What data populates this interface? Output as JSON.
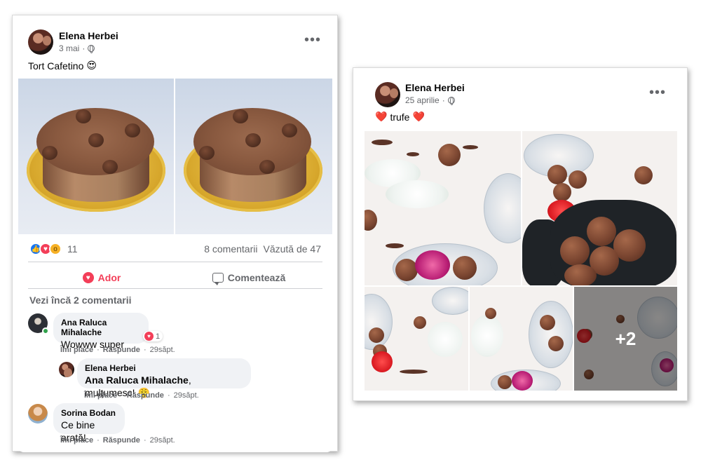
{
  "left_post": {
    "author": "Elena Herbei",
    "date": "3 mai",
    "separator": "·",
    "text": "Tort Cafetino",
    "text_emoji": "😍",
    "reaction_count": "11",
    "comments_count": "8 comentarii",
    "views": "Văzută de 47",
    "actions": {
      "like": "Ador",
      "comment": "Comentează"
    },
    "see_more": "Vezi încă 2 comentarii",
    "comments": [
      {
        "name": "Ana Raluca Mihalache",
        "text": "Wowww super",
        "reactions": "1",
        "like": "Îmi place",
        "reply": "Răspunde",
        "time": "29săpt."
      },
      {
        "name": "Elena Herbei",
        "mention": "Ana Raluca Mihalache",
        "text": ", mulțumesc!",
        "emoji": "😤",
        "like": "Îmi place",
        "reply": "Răspunde",
        "time": "29săpt."
      },
      {
        "name": "Sorina Bodan",
        "text": "Ce bine arată!",
        "like": "Îmi place",
        "reply": "Răspunde",
        "time": "29săpt."
      }
    ]
  },
  "right_post": {
    "author": "Elena Herbei",
    "date": "25 aprilie",
    "separator": "·",
    "text": "trufe",
    "text_emoji": "❤️",
    "more_photos": "+2"
  },
  "icons": {
    "more": "more-options-icon",
    "privacy": "globe-icon",
    "love": "heart-icon",
    "comment": "comment-icon"
  },
  "colors": {
    "love_red": "#f33e58",
    "like_blue": "#1877f2",
    "secondary_text": "#65676b",
    "bubble_bg": "#f0f2f5"
  }
}
